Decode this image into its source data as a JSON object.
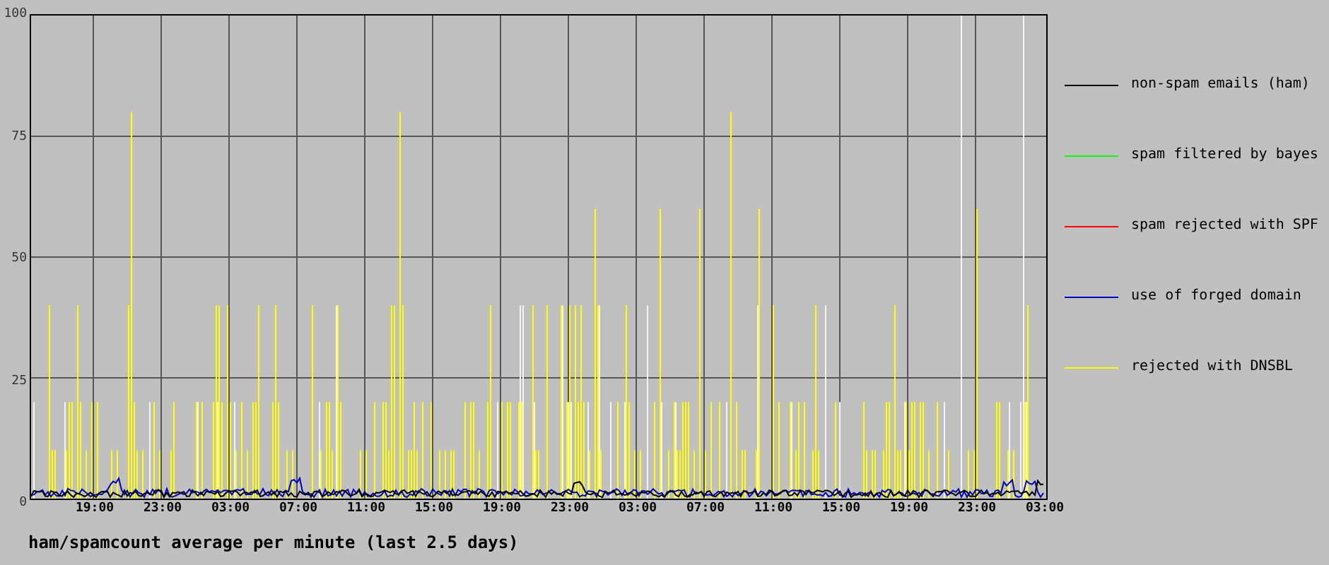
{
  "chart": {
    "y_labels": [
      "100",
      "75",
      "50",
      "25",
      "0"
    ],
    "x_labels": [
      "19:00",
      "23:00",
      "03:00",
      "07:00",
      "11:00",
      "15:00",
      "19:00",
      "23:00",
      "03:00",
      "07:00",
      "11:00",
      "15:00",
      "19:00",
      "23:00",
      "03:00"
    ],
    "legend": [
      {
        "label": "non-spam emails (ham)",
        "color": "#000000"
      },
      {
        "label": "spam filtered by bayes",
        "color": "#00ff00"
      },
      {
        "label": "spam rejected with SPF",
        "color": "#ff0000"
      },
      {
        "label": "use of forged domain",
        "color": "#0000c0"
      },
      {
        "label": "rejected with DNSBL",
        "color": "#ffff00"
      }
    ],
    "title": "ham/spamcount average per minute (last 2.5 days)"
  }
}
